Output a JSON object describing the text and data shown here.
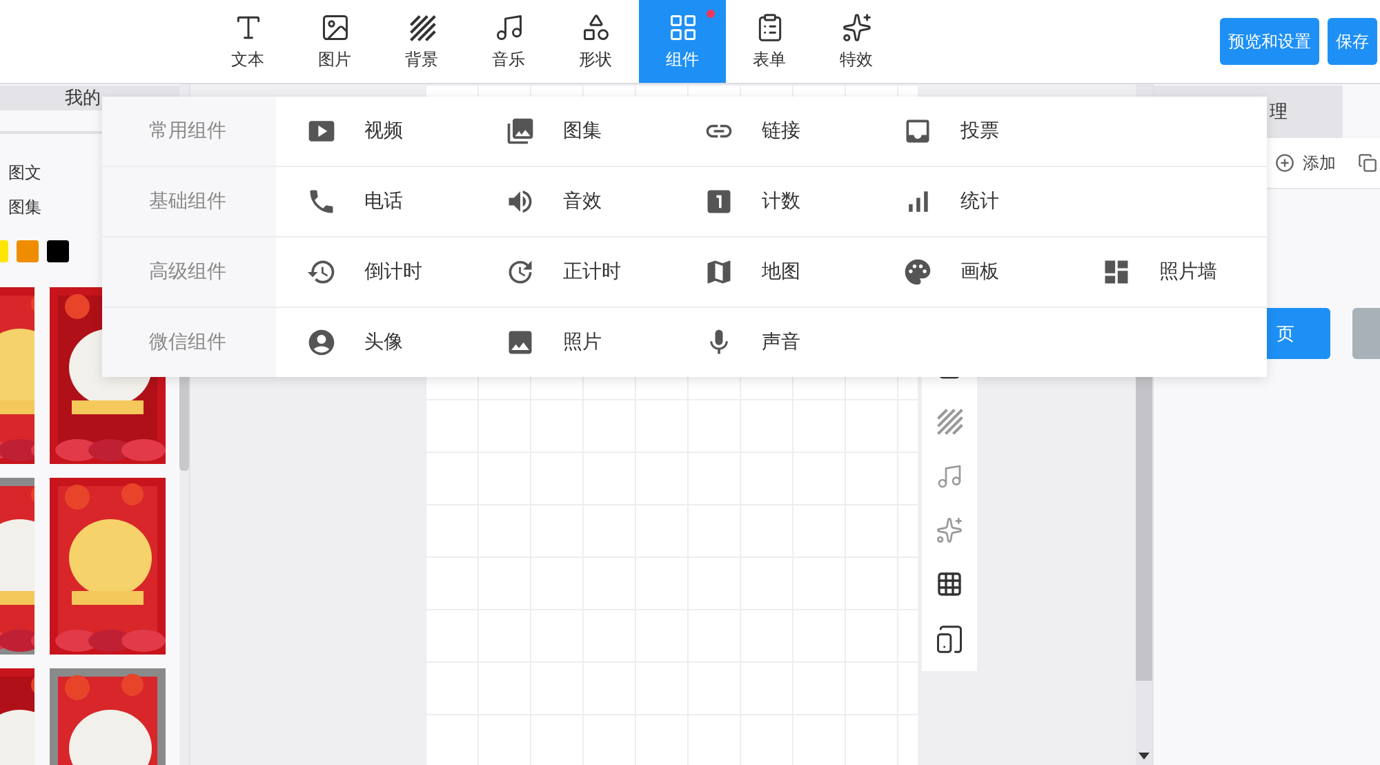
{
  "toolbar": {
    "tools": [
      {
        "label": "文本",
        "selected": false,
        "dot": false
      },
      {
        "label": "图片",
        "selected": false,
        "dot": false
      },
      {
        "label": "背景",
        "selected": false,
        "dot": false
      },
      {
        "label": "音乐",
        "selected": false,
        "dot": false
      },
      {
        "label": "形状",
        "selected": false,
        "dot": false
      },
      {
        "label": "组件",
        "selected": true,
        "dot": true
      },
      {
        "label": "表单",
        "selected": false,
        "dot": false
      },
      {
        "label": "特效",
        "selected": false,
        "dot": false
      }
    ],
    "buttons": [
      "预览和设置",
      "保存"
    ]
  },
  "left_panel": {
    "tab": "我的",
    "categories": [
      "图文",
      "图集"
    ],
    "swatches": [
      {
        "color": "#ffe600"
      },
      {
        "color": "#f08c00"
      },
      {
        "color": "#000000"
      }
    ],
    "templates": [
      {
        "kind": "picture"
      },
      {
        "kind": "picture"
      },
      {
        "kind": "picture"
      },
      {
        "kind": "picture"
      },
      {
        "kind": "picture"
      },
      {
        "kind": "picture"
      }
    ]
  },
  "right_panel": {
    "tab": "理",
    "add": "添加",
    "primary_button": "页"
  },
  "component_menu": [
    {
      "group": "常用组件",
      "items": [
        "视频",
        "图集",
        "链接",
        "投票"
      ]
    },
    {
      "group": "基础组件",
      "items": [
        "电话",
        "音效",
        "计数",
        "统计"
      ]
    },
    {
      "group": "高级组件",
      "items": [
        "倒计时",
        "正计时",
        "地图",
        "画板",
        "照片墙"
      ]
    },
    {
      "group": "微信组件",
      "items": [
        "头像",
        "照片",
        "声音"
      ]
    }
  ]
}
